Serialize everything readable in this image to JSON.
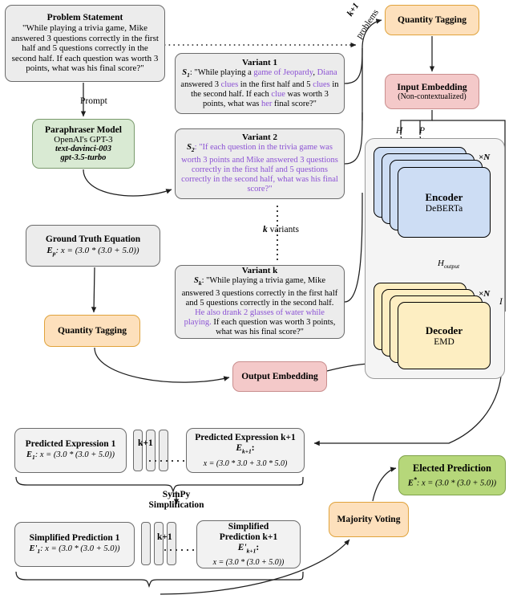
{
  "problem": {
    "title": "Problem Statement",
    "body": "\"While playing a trivia game, Mike answered 3 questions correctly in the first half and 5 questions correctly in the second half. If each question was worth 3 points, what was his final score?\""
  },
  "prompt_label": "Prompt",
  "paraphraser": {
    "title": "Paraphraser Model",
    "line2": "OpenAI's GPT-3",
    "line3": "text-davinci-003",
    "line4": "gpt-3.5-turbo"
  },
  "ground_truth": {
    "title": "Ground Truth Equation",
    "symbol": "E",
    "subscript": "p",
    "equation": ": x = (3.0 * (3.0 + 5.0))"
  },
  "quantity_tagging_left": {
    "title": "Quantity Tagging"
  },
  "variants": {
    "k_variants_label": "k variants",
    "items": [
      {
        "title": "Variant 1",
        "symbol": "S",
        "subscript": "1",
        "segments": [
          {
            "text": ": \"While playing a ",
            "purple": false
          },
          {
            "text": "game of Jeopardy",
            "purple": true
          },
          {
            "text": ", ",
            "purple": false
          },
          {
            "text": "Diana",
            "purple": true
          },
          {
            "text": " answered 3 ",
            "purple": false
          },
          {
            "text": "clues",
            "purple": true
          },
          {
            "text": " in the first half and 5 ",
            "purple": false
          },
          {
            "text": "clues",
            "purple": true
          },
          {
            "text": " in the second half. If each ",
            "purple": false
          },
          {
            "text": "clue",
            "purple": true
          },
          {
            "text": " was worth 3 points, what was ",
            "purple": false
          },
          {
            "text": "her",
            "purple": true
          },
          {
            "text": " final score?\"",
            "purple": false
          }
        ]
      },
      {
        "title": "Variant 2",
        "symbol": "S",
        "subscript": "2",
        "segments": [
          {
            "text": ": \"If each question in the trivia game was worth 3 points and Mike answered 3 questions correctly in the first half and 5 questions correctly in the second half, what was his final score?\"",
            "purple": true
          }
        ]
      },
      {
        "title": "Variant k",
        "symbol": "S",
        "subscript": "k",
        "segments": [
          {
            "text": ": \"While playing a trivia game, Mike answered 3 questions correctly in the first half and 5 questions correctly in the second half. ",
            "purple": false
          },
          {
            "text": "He also drank 2 glasses of water while playing.",
            "purple": true
          },
          {
            "text": " If each question was worth 3 points, what was his final score?\"",
            "purple": false
          }
        ]
      }
    ]
  },
  "kplus1_problems": {
    "line1": "k+1",
    "line2": "problems"
  },
  "quantity_tagging_right": {
    "title": "Quantity Tagging"
  },
  "input_embedding": {
    "title": "Input Embedding",
    "subtitle": "(Non-contextualized)"
  },
  "output_embedding": {
    "title": "Output Embedding"
  },
  "model": {
    "encoder": {
      "title": "Encoder",
      "subtitle": "DeBERTa",
      "repeat": "×N"
    },
    "decoder": {
      "title": "Decoder",
      "subtitle": "EMD",
      "repeat": "×N"
    },
    "labels": {
      "H": "H",
      "P": "P",
      "H_output": "H",
      "H_output_sub": "output",
      "I": "I"
    }
  },
  "predictions": {
    "first": {
      "title": "Predicted Expression 1",
      "symbol": "E",
      "subscript": "1",
      "equation": ": x = (3.0 * (3.0 + 5.0))"
    },
    "last": {
      "title": "Predicted Expression k+1",
      "symbol": "E",
      "subscript": "k+1",
      "equation": "x = (3.0 * 3.0 + 3.0 * 5.0)"
    },
    "count_label": "k+1"
  },
  "sympy": {
    "line1": "SymPy",
    "line2": "Simplification"
  },
  "simplified": {
    "first": {
      "title": "Simplified Prediction 1",
      "symbol": "E'",
      "subscript": "1",
      "equation": ": x = (3.0 * (3.0 + 5.0))"
    },
    "last": {
      "title_line1": "Simplified",
      "title_line2": "Prediction k+1",
      "symbol": "E'",
      "subscript": "k+1",
      "equation": "x = (3.0 * (3.0 + 5.0))"
    },
    "count_label": "k+1"
  },
  "majority_voting": {
    "title": "Majority Voting"
  },
  "elected": {
    "title": "Elected Prediction",
    "symbol": "E",
    "superscript": "*",
    "equation": ": x = (3.0 * (3.0 + 5.0))"
  },
  "colors": {
    "grey_box": "#ececec",
    "green_box": "#d9ead3",
    "orange_box": "#fde0bc",
    "pink_box": "#f4c9c9",
    "elected_green": "#b6d77a",
    "encoder_blue": "#cdddf4",
    "decoder_cream": "#fdeec2",
    "highlight_purple": "#8b51d4"
  }
}
